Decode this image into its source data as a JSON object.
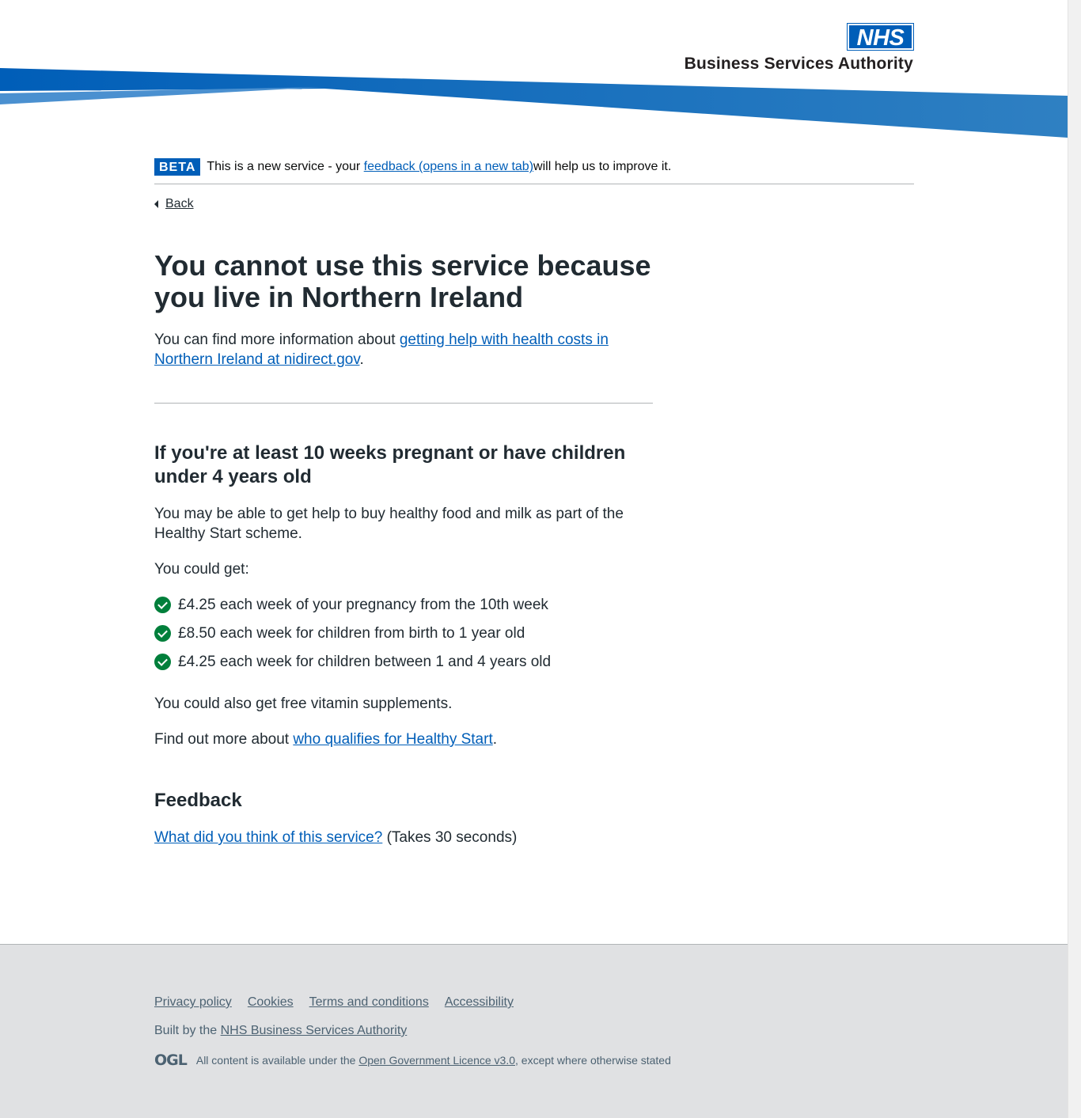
{
  "header": {
    "logo_nhs": "NHS",
    "logo_org": "Business Services Authority"
  },
  "phase_banner": {
    "tag": "BETA",
    "text_before": "This is a new service - your ",
    "link": "feedback (opens in a new tab)",
    "text_after": " will help us to improve it."
  },
  "back_link": "Back",
  "main": {
    "title": "You cannot use this service because you live in Northern Ireland",
    "info_before": "You can find more information about ",
    "info_link": "getting help with health costs in Northern Ireland at nidirect.gov",
    "info_after": ".",
    "section_heading": "If you're at least 10 weeks pregnant or have children under 4 years old",
    "paragraph1": "You may be able to get help to buy healthy food and milk as part of the Healthy Start scheme.",
    "paragraph2": "You could get:",
    "benefits": [
      "£4.25 each week of your pregnancy from the 10th week",
      "£8.50 each week for children from birth to 1 year old",
      "£4.25 each week for children between 1 and 4 years old"
    ],
    "paragraph3": "You could also get free vitamin supplements.",
    "find_out_before": "Find out more about ",
    "find_out_link": "who qualifies for Healthy Start",
    "find_out_after": ".",
    "feedback_heading": "Feedback",
    "feedback_link": "What did you think of this service?",
    "feedback_after": " (Takes 30 seconds)"
  },
  "footer": {
    "links": [
      "Privacy policy",
      "Cookies",
      "Terms and conditions",
      "Accessibility"
    ],
    "built_by_prefix": "Built by the ",
    "built_by_link": "NHS Business Services Authority",
    "ogl_logo": "OGL",
    "licence_before": "All content is available under the ",
    "licence_link": "Open Government Licence v3.0",
    "licence_after": ", except where otherwise stated"
  },
  "colors": {
    "nhs_blue": "#005eb8",
    "link": "#005eb8",
    "tick_green": "#007f3b",
    "footer_bg": "#e0e1e3",
    "text": "#212b32"
  }
}
